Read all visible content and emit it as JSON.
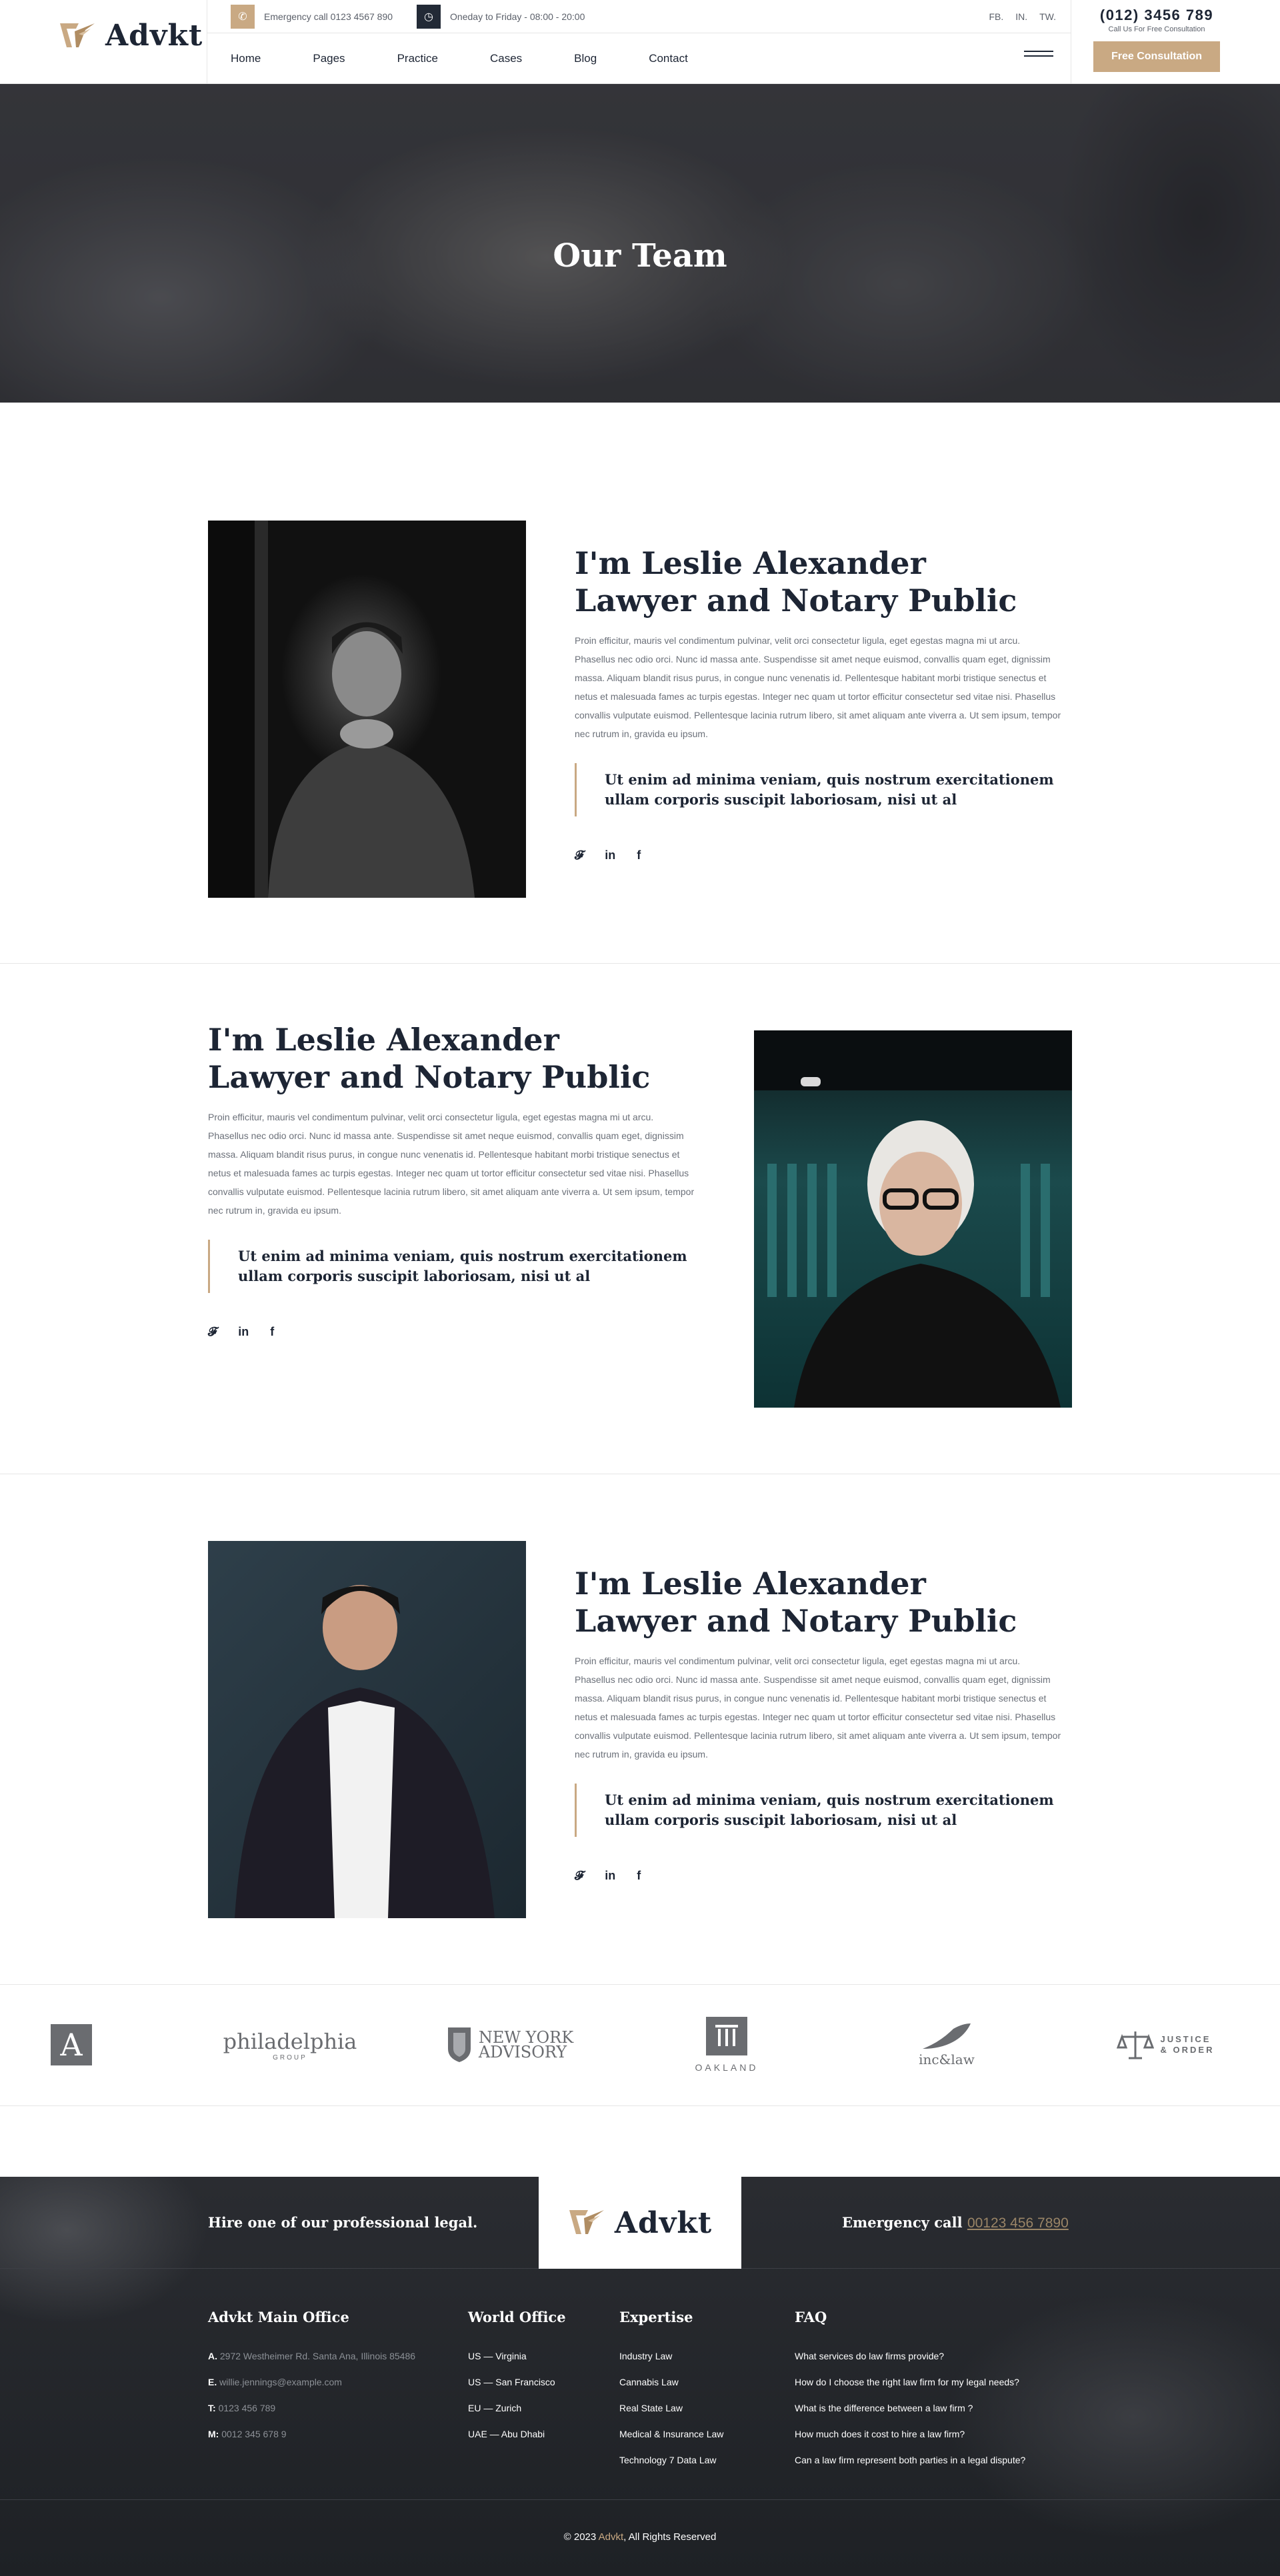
{
  "brand": {
    "name": "Advkt",
    "accent": "#c9a983",
    "dark": "#1d2534"
  },
  "topbar": {
    "emergency": "Emergency call 0123 4567 890",
    "hours": "Oneday to Friday - 08:00 - 20:00",
    "social": [
      "FB.",
      "IN.",
      "TW."
    ]
  },
  "nav": [
    "Home",
    "Pages",
    "Practice",
    "Cases",
    "Blog",
    "Contact"
  ],
  "header": {
    "phone": "(012) 3456 789",
    "phone_sub": "Call Us For Free Consultation",
    "cta": "Free Consultation"
  },
  "hero": {
    "title": "Our Team"
  },
  "team": [
    {
      "name_line1": "I'm Leslie Alexander",
      "name_line2": "Lawyer and Notary Public",
      "bio": "Proin efficitur, mauris vel condimentum pulvinar, velit orci consectetur ligula, eget egestas magna mi ut arcu. Phasellus nec odio orci. Nunc id massa ante. Suspendisse sit amet neque euismod, convallis quam eget, dignissim massa. Aliquam blandit risus purus, in congue nunc venenatis id. Pellentesque habitant morbi tristique senectus et netus et malesuada fames ac turpis egestas. Integer nec quam ut tortor efficitur consectetur sed vitae nisi. Phasellus convallis vulputate euismod. Pellentesque lacinia rutrum libero, sit amet aliquam ante viverra a. Ut sem ipsum, tempor nec rutrum in, gravida eu ipsum.",
      "quote": "Ut enim ad minima veniam, quis nostrum exercitationem ullam corporis suscipit laboriosam, nisi ut al"
    },
    {
      "name_line1": "I'm Leslie Alexander",
      "name_line2": "Lawyer and Notary Public",
      "bio": "Proin efficitur, mauris vel condimentum pulvinar, velit orci consectetur ligula, eget egestas magna mi ut arcu. Phasellus nec odio orci. Nunc id massa ante. Suspendisse sit amet neque euismod, convallis quam eget, dignissim massa. Aliquam blandit risus purus, in congue nunc venenatis id. Pellentesque habitant morbi tristique senectus et netus et malesuada fames ac turpis egestas. Integer nec quam ut tortor efficitur consectetur sed vitae nisi. Phasellus convallis vulputate euismod. Pellentesque lacinia rutrum libero, sit amet aliquam ante viverra a. Ut sem ipsum, tempor nec rutrum in, gravida eu ipsum.",
      "quote": "Ut enim ad minima veniam, quis nostrum exercitationem ullam corporis suscipit laboriosam, nisi ut al"
    },
    {
      "name_line1": "I'm Leslie Alexander",
      "name_line2": "Lawyer and Notary Public",
      "bio": "Proin efficitur, mauris vel condimentum pulvinar, velit orci consectetur ligula, eget egestas magna mi ut arcu. Phasellus nec odio orci. Nunc id massa ante. Suspendisse sit amet neque euismod, convallis quam eget, dignissim massa. Aliquam blandit risus purus, in congue nunc venenatis id. Pellentesque habitant morbi tristique senectus et netus et malesuada fames ac turpis egestas. Integer nec quam ut tortor efficitur consectetur sed vitae nisi. Phasellus convallis vulputate euismod. Pellentesque lacinia rutrum libero, sit amet aliquam ante viverra a. Ut sem ipsum, tempor nec rutrum in, gravida eu ipsum.",
      "quote": "Ut enim ad minima veniam, quis nostrum exercitationem ullam corporis suscipit laboriosam, nisi ut al"
    }
  ],
  "social_icons": [
    "twitter-icon",
    "linkedin-icon",
    "facebook-icon"
  ],
  "partners": {
    "a": "A",
    "philadelphia": "philadelphia",
    "philadelphia_sub": "GROUP",
    "ny_line1": "NEW YORK",
    "ny_line2": "ADVISORY",
    "oakland": "OAKLAND",
    "inclaw": "inc&law",
    "justice_line1": "JUSTICE",
    "justice_line2": "& ORDER"
  },
  "footer": {
    "hire": "Hire one of our professional legal.",
    "emergency_label": "Emergency call",
    "emergency_number": "00123 456 7890",
    "office": {
      "title": "Advkt Main Office",
      "address_label": "A.",
      "address": "2972 Westheimer Rd. Santa Ana, Illinois 85486",
      "email_label": "E.",
      "email": "willie.jennings@example.com",
      "tel_label": "T:",
      "tel": "0123 456 789",
      "mob_label": "M:",
      "mob": "0012 345 678 9"
    },
    "world": {
      "title": "World Office",
      "items": [
        "US — Virginia",
        "US — San Francisco",
        "EU — Zurich",
        "UAE — Abu Dhabi"
      ]
    },
    "expertise": {
      "title": "Expertise",
      "items": [
        "Industry Law",
        "Cannabis Law",
        "Real State Law",
        "Medical & Insurance Law",
        "Technology 7 Data Law"
      ]
    },
    "faq": {
      "title": "FAQ",
      "items": [
        "What services do law firms provide?",
        "How do I choose the right law firm for my legal needs?",
        "What is the difference between a law firm ?",
        "How much does it cost to hire a law firm?",
        "Can a law firm represent both parties in a legal dispute?"
      ]
    },
    "copy_pre": "© 2023",
    "copy_brand": "Advkt",
    "copy_post": ", All Rights Reserved"
  }
}
